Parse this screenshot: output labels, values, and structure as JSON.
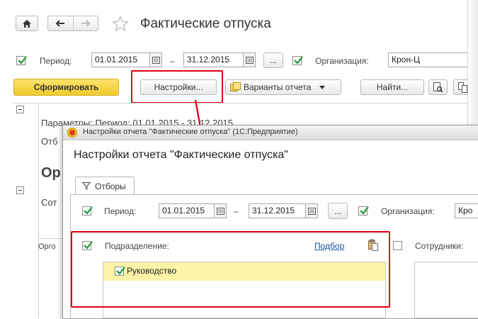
{
  "main": {
    "title": "Фактические отпуска",
    "period_label": "Период:",
    "period_from": "01.01.2015",
    "period_dash": "–",
    "period_to": "31.12.2015",
    "ellipsis": "...",
    "org_label": "Организация:",
    "org_value": "Крон-Ц",
    "generate_button": "Сформировать",
    "settings_button": "Настройки...",
    "variants_button": "Варианты отчета",
    "find_button": "Найти...",
    "report_lines": [
      "Параметры:    Период: 01.01.2015 - 31.12.2015",
      "Отб",
      "Ор",
      "Сот",
      "Орго"
    ]
  },
  "dialog": {
    "window_title": "Настройки отчета \"Фактические отпуска\"  (1С:Предприятие)",
    "heading": "Настройки отчета \"Фактические отпуска\"",
    "tab_label": "Отборы",
    "period_label": "Период:",
    "period_from": "01.01.2015",
    "period_dash": "–",
    "period_to": "31.12.2015",
    "ellipsis": "...",
    "org_label": "Организация:",
    "org_value": "Кро",
    "division_label": "Подразделение:",
    "pick_link": "Подбор",
    "employees_label": "Сотрудники:",
    "division_items": [
      "Руководство"
    ]
  },
  "colors": {
    "accent_yellow": "#f5d43a",
    "check_green": "#2ea043",
    "highlight_red": "#e0000f",
    "selection_yellow": "#fbf3a6",
    "link_blue": "#1a4fa0"
  }
}
